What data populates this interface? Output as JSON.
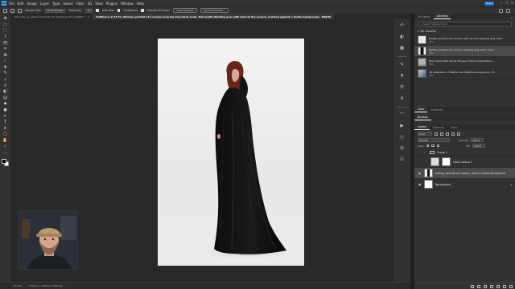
{
  "app": {
    "logo": "Ps",
    "menu": [
      "File",
      "Edit",
      "Image",
      "Layer",
      "Type",
      "Select",
      "Filter",
      "3D",
      "View",
      "Plugins",
      "Window",
      "Help"
    ],
    "share_label": "Share",
    "window_controls": [
      "—",
      "❐",
      "✕"
    ]
  },
  "options_bar": {
    "sample_size_label": "Sample Size:",
    "sample_size_value": "Point Sample",
    "tolerance_label": "Tolerance:",
    "tolerance_value": "32",
    "anti_alias_label": "Anti-alias",
    "contiguous_label": "Contiguous",
    "sample_all_layers_label": "Sample All Layers",
    "select_subject_label": "Select Subject",
    "select_and_mask_label": "Select and Mask..."
  },
  "tabs": [
    {
      "label": "Pill_book_sp_cables.psd @ 66.7% (Challenge Ele, RGB/8) *",
      "active": false
    },
    {
      "label": "Untitled-1 @ 33.3% (fantasy portrait of a woman wearing long black cloak, full length standing pose  with back to the camera, isolated against a studio background., RGB/8)",
      "active": true
    }
  ],
  "toolbar": {
    "tools": [
      {
        "name": "move-tool",
        "glyph": "✥"
      },
      {
        "name": "artboard-tool",
        "glyph": "▭"
      },
      {
        "name": "marquee-tool",
        "glyph": "⬚"
      },
      {
        "name": "lasso-tool",
        "glyph": "ℓ"
      },
      {
        "name": "magic-wand-tool",
        "glyph": "✦"
      },
      {
        "name": "crop-tool",
        "glyph": "⌗"
      },
      {
        "name": "frame-tool",
        "glyph": "⊠"
      },
      {
        "name": "eyedropper-tool",
        "glyph": "⁄"
      },
      {
        "name": "healing-brush-tool",
        "glyph": "✚"
      },
      {
        "name": "brush-tool",
        "glyph": "✎"
      },
      {
        "name": "clone-stamp-tool",
        "glyph": "⊥"
      },
      {
        "name": "history-brush-tool",
        "glyph": "↺"
      },
      {
        "name": "eraser-tool",
        "glyph": "◧"
      },
      {
        "name": "gradient-tool",
        "glyph": "▤"
      },
      {
        "name": "blur-tool",
        "glyph": "◆"
      },
      {
        "name": "dodge-tool",
        "glyph": "●"
      },
      {
        "name": "pen-tool",
        "glyph": "✒"
      },
      {
        "name": "type-tool",
        "glyph": "T"
      },
      {
        "name": "path-selection-tool",
        "glyph": "➤"
      },
      {
        "name": "rectangle-tool",
        "glyph": "▢"
      },
      {
        "name": "hand-tool",
        "glyph": "✋"
      },
      {
        "name": "zoom-tool",
        "glyph": "⌕"
      },
      {
        "name": "more-tools",
        "glyph": "…"
      }
    ],
    "foreground_color": "#000000",
    "background_color": "#ffffff"
  },
  "status": {
    "zoom": "33.33%",
    "doc_size": "1792 px x 2432 px (300 ppi)",
    "arrow": "›"
  },
  "right_strip": {
    "icons": [
      "history-icon",
      "adjustments-icon",
      "swatches-icon",
      "brush-settings-icon",
      "paragraph-icon",
      "properties-icon",
      "character-icon",
      "paths-icon",
      "actions-icon",
      "info-icon",
      "glyphs-icon",
      "libraries-icon"
    ],
    "glyphs": [
      "↶",
      "◐",
      "▦",
      "✎",
      "¶",
      "☰",
      "A",
      "⌒",
      "▶",
      "ⓘ",
      "Ω",
      "☷"
    ]
  },
  "panels": {
    "top_tabs": [
      "Navigator",
      "Libraries"
    ],
    "top_active": 1,
    "library": {
      "search_placeholder": "Search Adobe Stock",
      "group_name": "My Libraries",
      "items": [
        {
          "title": "fantasy portrait of a woman with red hair wearing long cloak",
          "meta": "JPEG"
        },
        {
          "title": "fantasy portrait of a woman wearing long black cloak...",
          "meta": "JPEG",
          "selected": true
        },
        {
          "title": "Morro Rock with Sandy Shores of Morro Creek Beach...",
          "meta": "JPEG"
        },
        {
          "title": "3D illustration of abstract architecture background, M...",
          "meta": "JPEG"
        }
      ]
    },
    "color_tabs": [
      "Color",
      "Swatches"
    ],
    "brushes_tab": "Brushes",
    "layers_tabs": [
      "Layers",
      "Channels",
      "Paths"
    ],
    "layers_filter_label": "Kind",
    "blend_mode": "Normal",
    "opacity_label": "Opacity:",
    "opacity_value": "100%",
    "lock_label": "Lock:",
    "fill_label": "Fill:",
    "fill_value": "100%",
    "layers": [
      {
        "name": "Group 1",
        "type": "group"
      },
      {
        "name": "Color Lookup 1",
        "type": "adjustment"
      },
      {
        "name": "fantasy portrait of a woma...ainst a studio background.",
        "type": "image",
        "selected": true
      },
      {
        "name": "Background",
        "type": "background"
      }
    ]
  },
  "colors": {
    "accent": "#31a8ff",
    "share": "#1473e6",
    "panel_bg": "#323232",
    "canvas_bg": "#282828"
  }
}
